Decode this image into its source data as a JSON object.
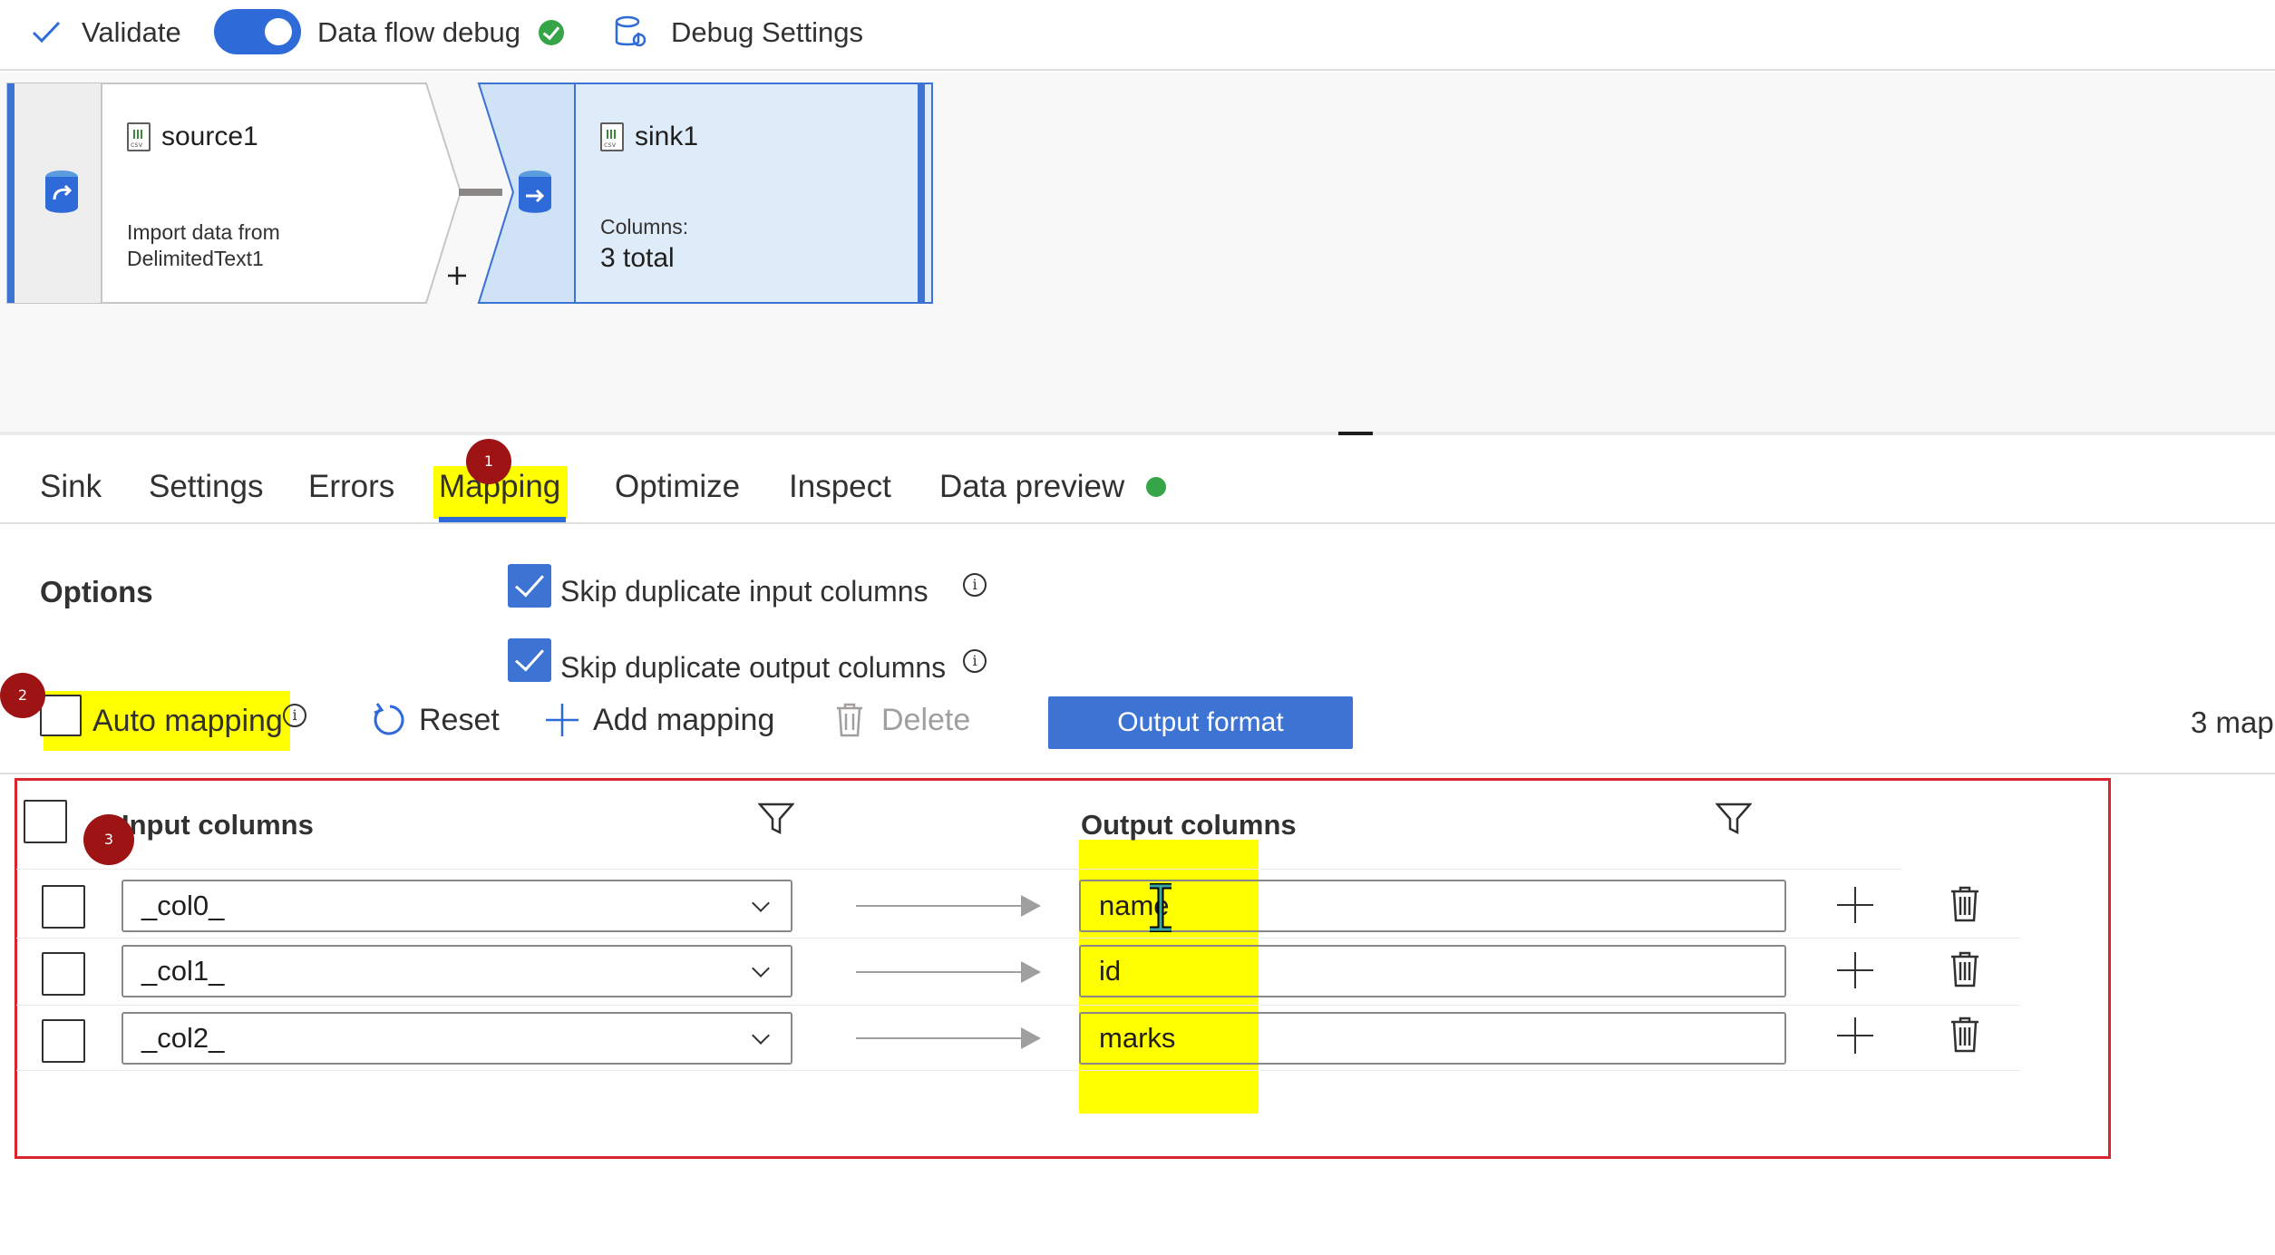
{
  "toolbar": {
    "validate_label": "Validate",
    "debug_toggle_label": "Data flow debug",
    "debug_settings_label": "Debug Settings"
  },
  "canvas": {
    "source_node": {
      "title": "source1",
      "desc_line1": "Import data from",
      "desc_line2": "DelimitedText1"
    },
    "sink_node": {
      "title": "sink1",
      "columns_label": "Columns:",
      "columns_value": "3 total"
    }
  },
  "tabs": [
    {
      "label": "Sink"
    },
    {
      "label": "Settings"
    },
    {
      "label": "Errors"
    },
    {
      "label": "Mapping"
    },
    {
      "label": "Optimize"
    },
    {
      "label": "Inspect"
    },
    {
      "label": "Data preview"
    }
  ],
  "annotations": {
    "step1": "1",
    "step2": "2",
    "step3": "3"
  },
  "options": {
    "heading": "Options",
    "skip_input_label": "Skip duplicate input columns",
    "skip_output_label": "Skip duplicate output columns"
  },
  "actions": {
    "auto_mapping": "Auto mapping",
    "reset": "Reset",
    "add_mapping": "Add mapping",
    "delete": "Delete",
    "output_format": "Output format",
    "mapped_count": "3 map"
  },
  "table": {
    "input_header": "Input columns",
    "output_header": "Output columns",
    "rows": [
      {
        "input": "_col0_",
        "output": "name"
      },
      {
        "input": "_col1_",
        "output": "id"
      },
      {
        "input": "_col2_",
        "output": "marks"
      }
    ]
  },
  "colors": {
    "accent": "#2f6bd8",
    "highlight": "#ffff00",
    "annotation": "#9e1313",
    "frame": "#d9262c",
    "success": "#36a548"
  }
}
